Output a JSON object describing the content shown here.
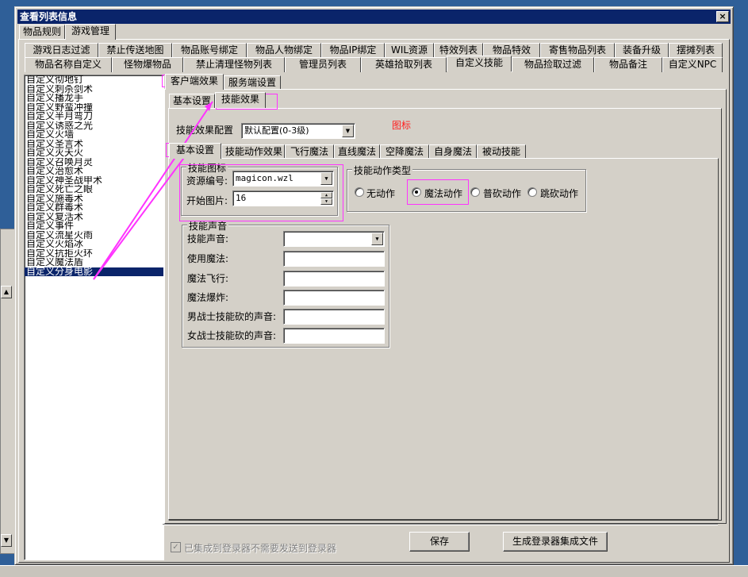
{
  "window": {
    "title": "查看列表信息",
    "close_label": "×"
  },
  "top_tabs": [
    "物品规则",
    "游戏管理"
  ],
  "row1_tabs": [
    "游戏日志过滤",
    "禁止传送地图",
    "物品账号绑定",
    "物品人物绑定",
    "物品IP绑定",
    "WIL资源",
    "特效列表",
    "物品特效",
    "寄售物品列表",
    "装备升级",
    "摆摊列表"
  ],
  "row2_tabs": [
    "物品名称自定义",
    "怪物爆物品",
    "禁止清理怪物列表",
    "管理员列表",
    "英雄拾取列表",
    "自定义技能",
    "物品捡取过滤",
    "物品备注",
    "自定义NPC"
  ],
  "skill_list": [
    "自定义彻地钉",
    "自定义刺杀剑术",
    "自定义播龙手",
    "自定义野蛮冲撞",
    "自定义半月弯刀",
    "自定义诱惑之光",
    "自定义火墙",
    "自定义圣言术",
    "自定义灭天火",
    "自定义召唤月灵",
    "自定义治愈术",
    "自定义神圣战甲术",
    "自定义死亡之眼",
    "自定义施毒术",
    "自定义群毒术",
    "自定义复活术",
    "自定义事件",
    "自定义流星火雨",
    "自定义火焰冰",
    "自定义抗拒火环",
    "自定义魔法盾",
    "自定义分身电影"
  ],
  "side_tabs": [
    "客户端效果",
    "服务端设置"
  ],
  "sub_tabs": [
    "基本设置",
    "技能效果"
  ],
  "effect_config": {
    "label": "技能效果配置",
    "value": "默认配置(0-3级)",
    "note": "图标"
  },
  "effect_tabs": [
    "基本设置",
    "技能动作效果",
    "飞行魔法",
    "直线魔法",
    "空降魔法",
    "自身魔法",
    "被动技能"
  ],
  "icon_group": {
    "title": "技能图标",
    "resource_label": "资源编号:",
    "resource_value": "magicon.wzl",
    "start_label": "开始图片:",
    "start_value": "16"
  },
  "action_group": {
    "title": "技能动作类型",
    "options": [
      "无动作",
      "魔法动作",
      "普砍动作",
      "跳砍动作"
    ],
    "selected": 1
  },
  "sound_group": {
    "title": "技能声音",
    "labels": [
      "技能声音:",
      "使用魔法:",
      "魔法飞行:",
      "魔法爆炸:",
      "男战士技能砍的声音:",
      "女战士技能砍的声音:"
    ]
  },
  "footer": {
    "checkbox_label": "已集成到登录器不需要发送到登录器",
    "save_label": "保存",
    "generate_label": "生成登录器集成文件"
  }
}
